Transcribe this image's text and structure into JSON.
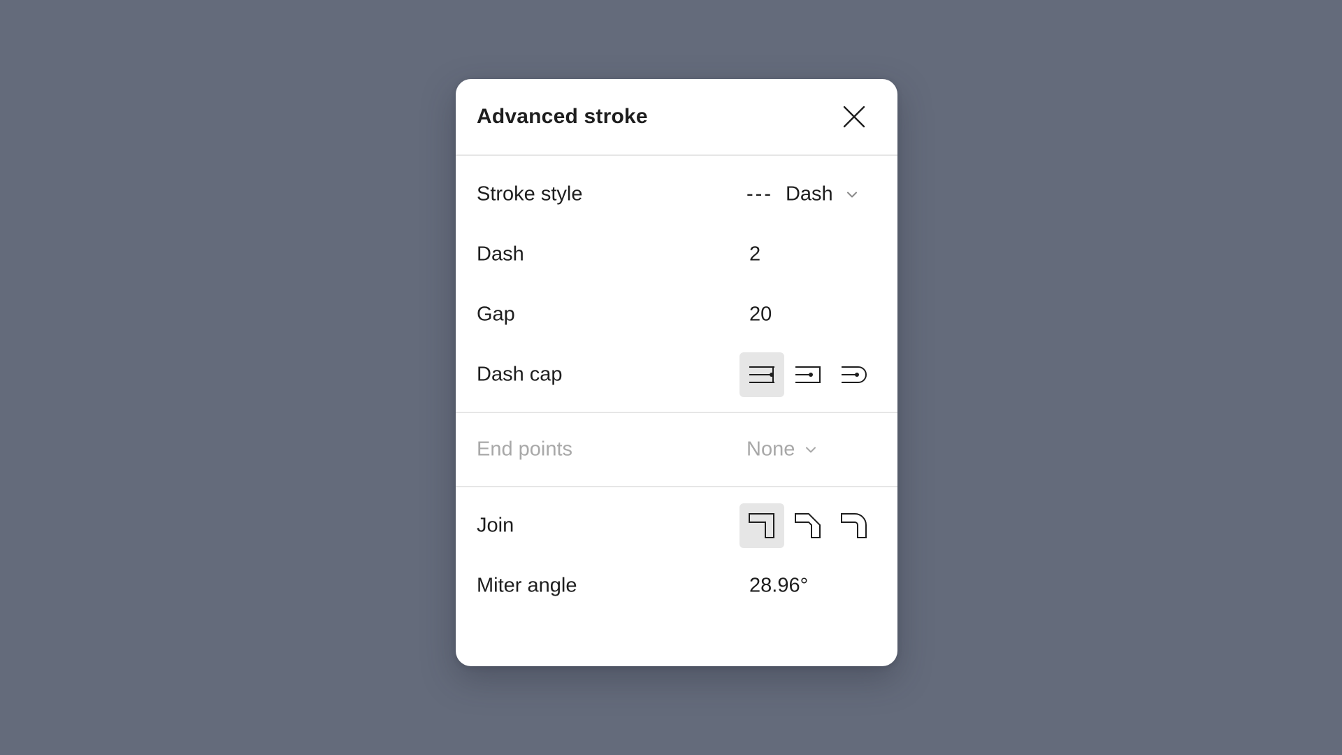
{
  "dialog": {
    "title": "Advanced stroke",
    "close_icon": "close-icon"
  },
  "stroke": {
    "style_label": "Stroke style",
    "style_preview": "---",
    "style_value": "Dash",
    "dash_label": "Dash",
    "dash_value": "2",
    "gap_label": "Gap",
    "gap_value": "20",
    "cap_label": "Dash cap",
    "cap_options": [
      {
        "icon": "cap-none-icon",
        "selected": true
      },
      {
        "icon": "cap-square-icon",
        "selected": false
      },
      {
        "icon": "cap-round-icon",
        "selected": false
      }
    ]
  },
  "endpoints": {
    "label": "End points",
    "value": "None",
    "disabled": true
  },
  "join": {
    "label": "Join",
    "options": [
      {
        "icon": "join-miter-icon",
        "selected": true
      },
      {
        "icon": "join-bevel-icon",
        "selected": false
      },
      {
        "icon": "join-round-icon",
        "selected": false
      }
    ],
    "miter_label": "Miter angle",
    "miter_value": "28.96°"
  },
  "colors": {
    "background": "#646b7b",
    "panel": "#ffffff",
    "text": "#1e1e1e",
    "muted": "#a8a8a8",
    "selected": "#e6e6e6",
    "divider": "#e6e6e6"
  }
}
